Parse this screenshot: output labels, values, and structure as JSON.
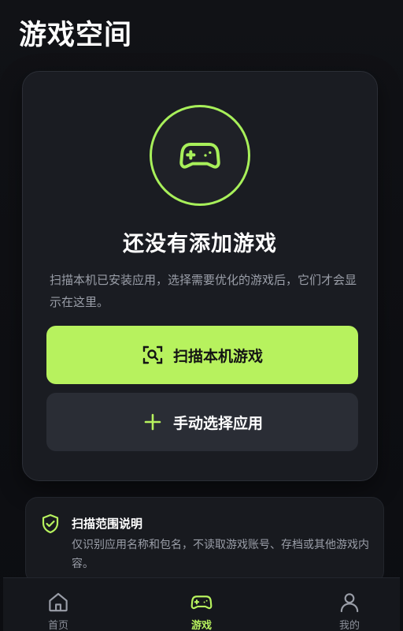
{
  "header": {
    "title": "游戏空间"
  },
  "empty_state": {
    "icon": "gamepad-icon",
    "title": "还没有添加游戏",
    "description": "扫描本机已安装应用，选择需要优化的游戏后，它们才会显示在这里。",
    "primary_button": {
      "label": "扫描本机游戏",
      "icon": "scan-icon"
    },
    "secondary_button": {
      "label": "手动选择应用",
      "icon": "plus-icon"
    }
  },
  "info": {
    "icon": "shield-check-icon",
    "title": "扫描范围说明",
    "text": "仅识别应用名称和包名，不读取游戏账号、存档或其他游戏内容。"
  },
  "bottom_nav": {
    "items": [
      {
        "label": "首页",
        "icon": "home-icon",
        "active": false
      },
      {
        "label": "游戏",
        "icon": "gamepad-icon",
        "active": true
      },
      {
        "label": "我的",
        "icon": "user-icon",
        "active": false
      }
    ]
  },
  "colors": {
    "accent": "#b7f25e",
    "background": "#0d0e12",
    "card": "#1a1c22",
    "secondary_button": "#2a2d35",
    "muted_text": "#9a9ea8"
  }
}
